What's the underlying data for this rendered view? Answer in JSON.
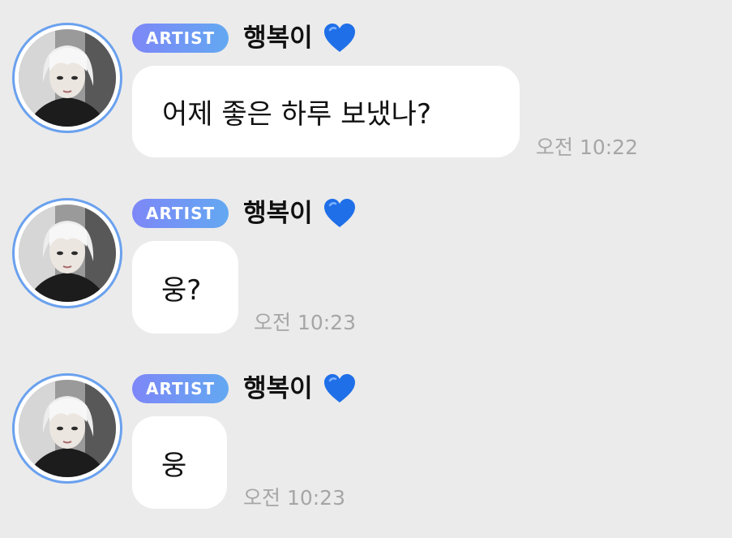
{
  "sender": {
    "badge": "ARTIST",
    "name": "행복이",
    "heart": "💙",
    "heart_color": "#1f6fe8",
    "avatar": "artist-photo"
  },
  "messages": [
    {
      "text": "어제 좋은 하루 보냈나?",
      "time": "오전 10:22"
    },
    {
      "text": "웅?",
      "time": "오전 10:23"
    },
    {
      "text": "웅",
      "time": "오전 10:23"
    }
  ],
  "colors": {
    "background": "#ebebeb",
    "bubble": "#ffffff",
    "badge_start": "#7d87f7",
    "badge_end": "#63a8f2",
    "avatar_ring": "#6aa1ee",
    "timestamp": "#a6a6a6"
  }
}
